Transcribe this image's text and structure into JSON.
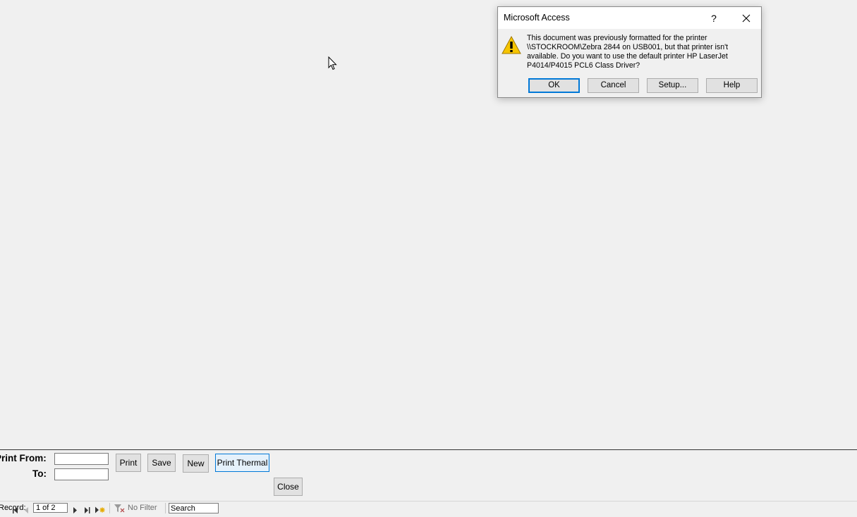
{
  "dialog": {
    "title": "Microsoft Access",
    "help_glyph": "?",
    "close_icon": "close-icon",
    "icon": "warning-icon",
    "message": "This document was previously formatted for the printer \\\\STOCKROOM\\Zebra 2844 on USB001, but that printer isn't available. Do you want to use the default printer HP LaserJet P4014/P4015 PCL6 Class Driver?",
    "buttons": {
      "ok": "OK",
      "cancel": "Cancel",
      "setup": "Setup...",
      "help": "Help"
    }
  },
  "form": {
    "print_from_label": "Print From:",
    "to_label": "To:",
    "print_from_value": "",
    "to_value": "",
    "buttons": {
      "print": "Print",
      "save": "Save",
      "new": "New",
      "print_thermal": "Print Thermal",
      "close": "Close"
    }
  },
  "record_nav": {
    "label": "Record:",
    "position": "1 of 2",
    "filter": "No Filter",
    "search_placeholder": "Search"
  },
  "colors": {
    "background": "#f0f0f0",
    "accent": "#0078d7",
    "warning": "#f6c500"
  }
}
